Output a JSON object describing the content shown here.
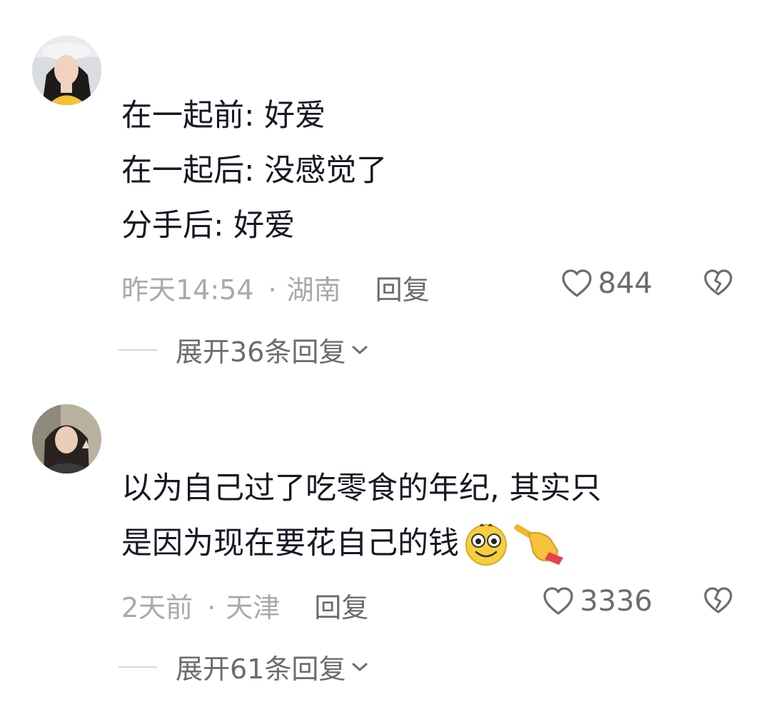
{
  "comments": [
    {
      "lines": [
        "在一起前: 好爱",
        "在一起后: 没感觉了",
        "分手后: 好爱"
      ],
      "time": "昨天14:54",
      "separator": "·",
      "location": "湖南",
      "reply_label": "回复",
      "likes": "844",
      "expand_label": "展开36条回复"
    },
    {
      "lines": [
        "以为自己过了吃零食的年纪, 其实只",
        "是因为现在要花自己的钱"
      ],
      "emojis": [
        "goofy-face-emoji",
        "pointing-hand-emoji"
      ],
      "time": "2天前",
      "separator": "·",
      "location": "天津",
      "reply_label": "回复",
      "likes": "3336",
      "expand_label": "展开61条回复"
    }
  ],
  "icons": {
    "like": "heart-outline-icon",
    "dislike": "broken-heart-icon",
    "expand": "chevron-down-icon"
  }
}
